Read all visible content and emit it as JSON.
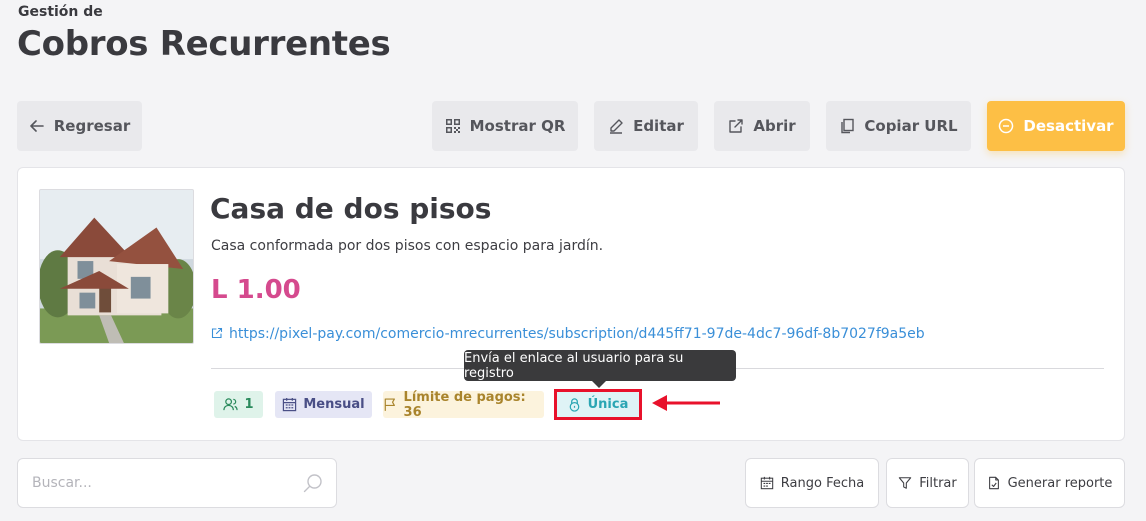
{
  "header": {
    "subtitle": "Gestión de",
    "title": "Cobros Recurrentes"
  },
  "actions": {
    "back_label": "Regresar",
    "qr_label": "Mostrar QR",
    "edit_label": "Editar",
    "open_label": "Abrir",
    "copy_url_label": "Copiar URL",
    "deactivate_label": "Desactivar"
  },
  "product": {
    "name": "Casa de dos pisos",
    "description": "Casa conformada por dos pisos con espacio para jardín.",
    "price": "L 1.00",
    "url": "https://pixel-pay.com/comercio-mrecurrentes/subscription/d445ff71-97de-4dc7-96df-8b7027f9a5eb"
  },
  "badges": {
    "users": "1",
    "frequency": "Mensual",
    "payment_limit": "Límite de pagos: 36",
    "type": "Única"
  },
  "tooltip": {
    "text": "Envía el enlace al usuario para su registro"
  },
  "search": {
    "placeholder": "Buscar..."
  },
  "toolbar": {
    "date_range_label": "Rango Fecha",
    "filter_label": "Filtrar",
    "report_label": "Generar reporte"
  },
  "colors": {
    "accent": "#fdbf45",
    "price": "#d54a8e",
    "link": "#3a8fd8",
    "highlight": "#e8112b"
  },
  "icons": {
    "back": "arrow-left-icon",
    "qr": "qr-code-icon",
    "edit": "pencil-icon",
    "open": "external-link-icon",
    "copy": "copy-icon",
    "deactivate": "minus-circle-icon",
    "users": "users-icon",
    "frequency": "calendar-icon",
    "limit": "flag-icon",
    "type": "lock-icon",
    "search": "search-icon",
    "date_range": "calendar-icon",
    "filter": "filter-icon",
    "report": "document-icon"
  }
}
